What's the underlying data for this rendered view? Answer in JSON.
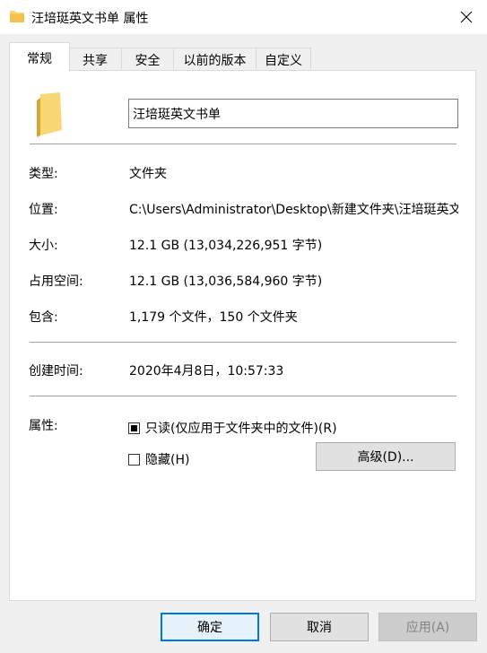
{
  "window": {
    "title": "汪培珽英文书单 属性",
    "close_glyph": "✕"
  },
  "tabs": [
    {
      "label": "常规",
      "active": true
    },
    {
      "label": "共享"
    },
    {
      "label": "安全"
    },
    {
      "label": "以前的版本"
    },
    {
      "label": "自定义"
    }
  ],
  "general": {
    "name_value": "汪培珽英文书单",
    "type": {
      "label": "类型:",
      "value": "文件夹"
    },
    "location": {
      "label": "位置:",
      "value": "C:\\Users\\Administrator\\Desktop\\新建文件夹\\汪培珽英文书单"
    },
    "size": {
      "label": "大小:",
      "value": "12.1 GB (13,034,226,951 字节)"
    },
    "size_on_disk": {
      "label": "占用空间:",
      "value": "12.1 GB (13,036,584,960 字节)"
    },
    "contains": {
      "label": "包含:",
      "value": "1,179 个文件，150 个文件夹"
    },
    "created": {
      "label": "创建时间:",
      "value": "2020年4月8日，10:57:33"
    },
    "attributes": {
      "label": "属性:",
      "readonly": {
        "label": "只读(仅应用于文件夹中的文件)(R)",
        "state": "indeterminate"
      },
      "hidden": {
        "label": "隐藏(H)",
        "checked": false
      },
      "advanced_label": "高级(D)..."
    }
  },
  "buttons": {
    "ok": "确定",
    "cancel": "取消",
    "apply": "应用(A)"
  },
  "colors": {
    "folder_yellow": "#f8d775",
    "folder_dark": "#e2b13c",
    "accent": "#0078d7"
  },
  "icons": {
    "title": "folder-icon",
    "large": "folder-icon",
    "close": "close-icon"
  }
}
